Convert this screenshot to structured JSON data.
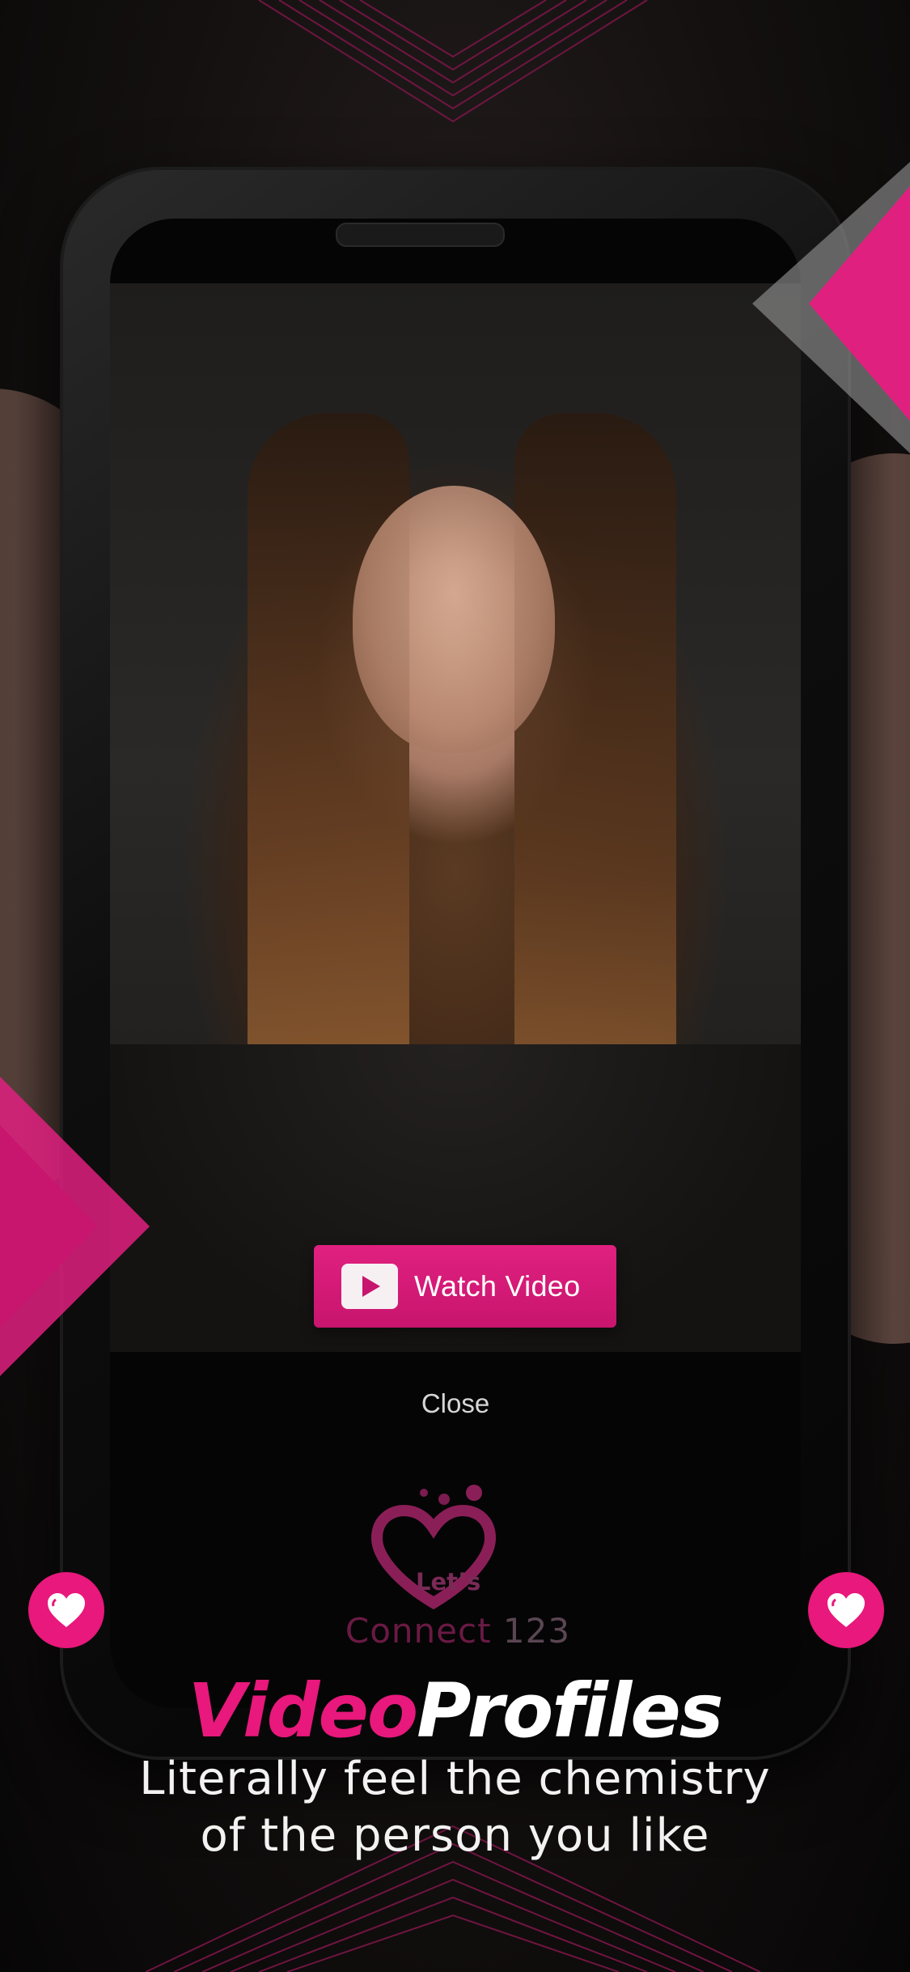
{
  "screen": {
    "watch_video_label": "Watch Video",
    "close_label": "Close"
  },
  "logo": {
    "lets_text": "Let’s",
    "brand_text": "Connect",
    "brand_number": "123"
  },
  "marketing": {
    "headline_accent": "Video",
    "headline_main": "Profiles",
    "subline_1": "Literally feel the chemistry",
    "subline_2": "of the person you like"
  },
  "icons": {
    "play": "play-icon",
    "heart": "heart-icon",
    "logo_heart": "heart-logo-icon"
  },
  "colors": {
    "accent": "#e8187c",
    "button": "#d01873",
    "background": "#0b0909",
    "text": "#ffffff"
  }
}
